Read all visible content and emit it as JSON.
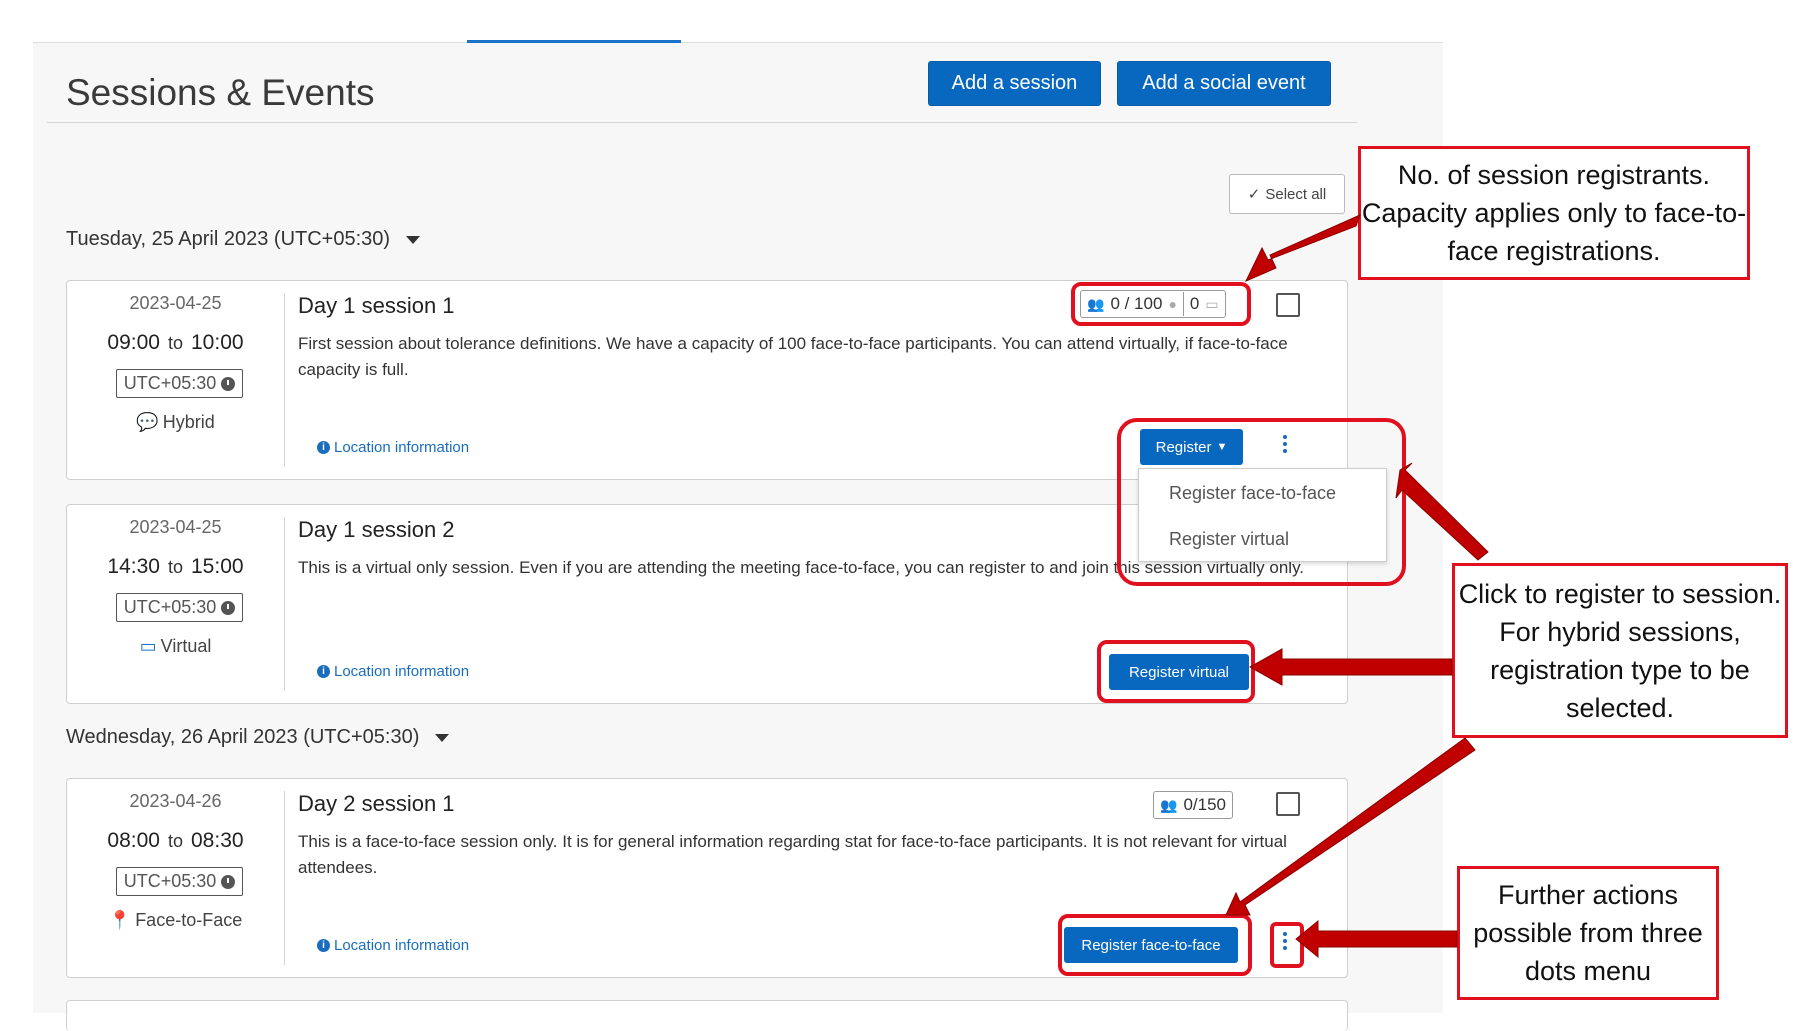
{
  "page": {
    "title": "Sessions & Events",
    "add_session": "Add a session",
    "add_social": "Add a social event",
    "select_all": "Select all"
  },
  "days": [
    {
      "heading": "Tuesday, 25 April 2023 (UTC+05:30)"
    },
    {
      "heading": "Wednesday, 26 April 2023 (UTC+05:30)"
    }
  ],
  "sessions": [
    {
      "date": "2023-04-25",
      "start": "09:00",
      "to": "to",
      "end": "10:00",
      "tz": "UTC+05:30",
      "mode": "Hybrid",
      "mode_icon": "hybrid-icon",
      "title": "Day 1 session 1",
      "desc": "First session about tolerance definitions. We have a capacity of 100 face-to-face participants. You can attend virtually, if face-to-face capacity is full.",
      "location": "Location information",
      "capacity_f2f": "0 / 100",
      "capacity_virtual": "0",
      "action": "Register"
    },
    {
      "date": "2023-04-25",
      "start": "14:30",
      "to": "to",
      "end": "15:00",
      "tz": "UTC+05:30",
      "mode": "Virtual",
      "mode_icon": "monitor-icon",
      "title": "Day 1 session 2",
      "desc": "This is a virtual only session. Even if you are attending the meeting face-to-face, you can register to and join this session virtually only.",
      "location": "Location information",
      "action": "Register virtual"
    },
    {
      "date": "2023-04-26",
      "start": "08:00",
      "to": "to",
      "end": "08:30",
      "tz": "UTC+05:30",
      "mode": "Face-to-Face",
      "mode_icon": "map-pin-icon",
      "title": "Day 2 session 1",
      "desc": "This is a face-to-face session only. It is for general information regarding stat for face-to-face participants. It is not relevant for virtual attendees.",
      "location": "Location information",
      "capacity": "0/150",
      "action": "Register face-to-face"
    }
  ],
  "dropdown": {
    "option1": "Register face-to-face",
    "option2": "Register virtual"
  },
  "callouts": {
    "registrants": "No. of session registrants. Capacity applies only to face-to-face registrations.",
    "register": "Click to register to session. For hybrid sessions, registration type to be selected.",
    "dots": "Further actions possible from three dots menu"
  },
  "colors": {
    "accent": "#0868c0",
    "annotation": "#e0101e",
    "arrow": "#c00000"
  }
}
